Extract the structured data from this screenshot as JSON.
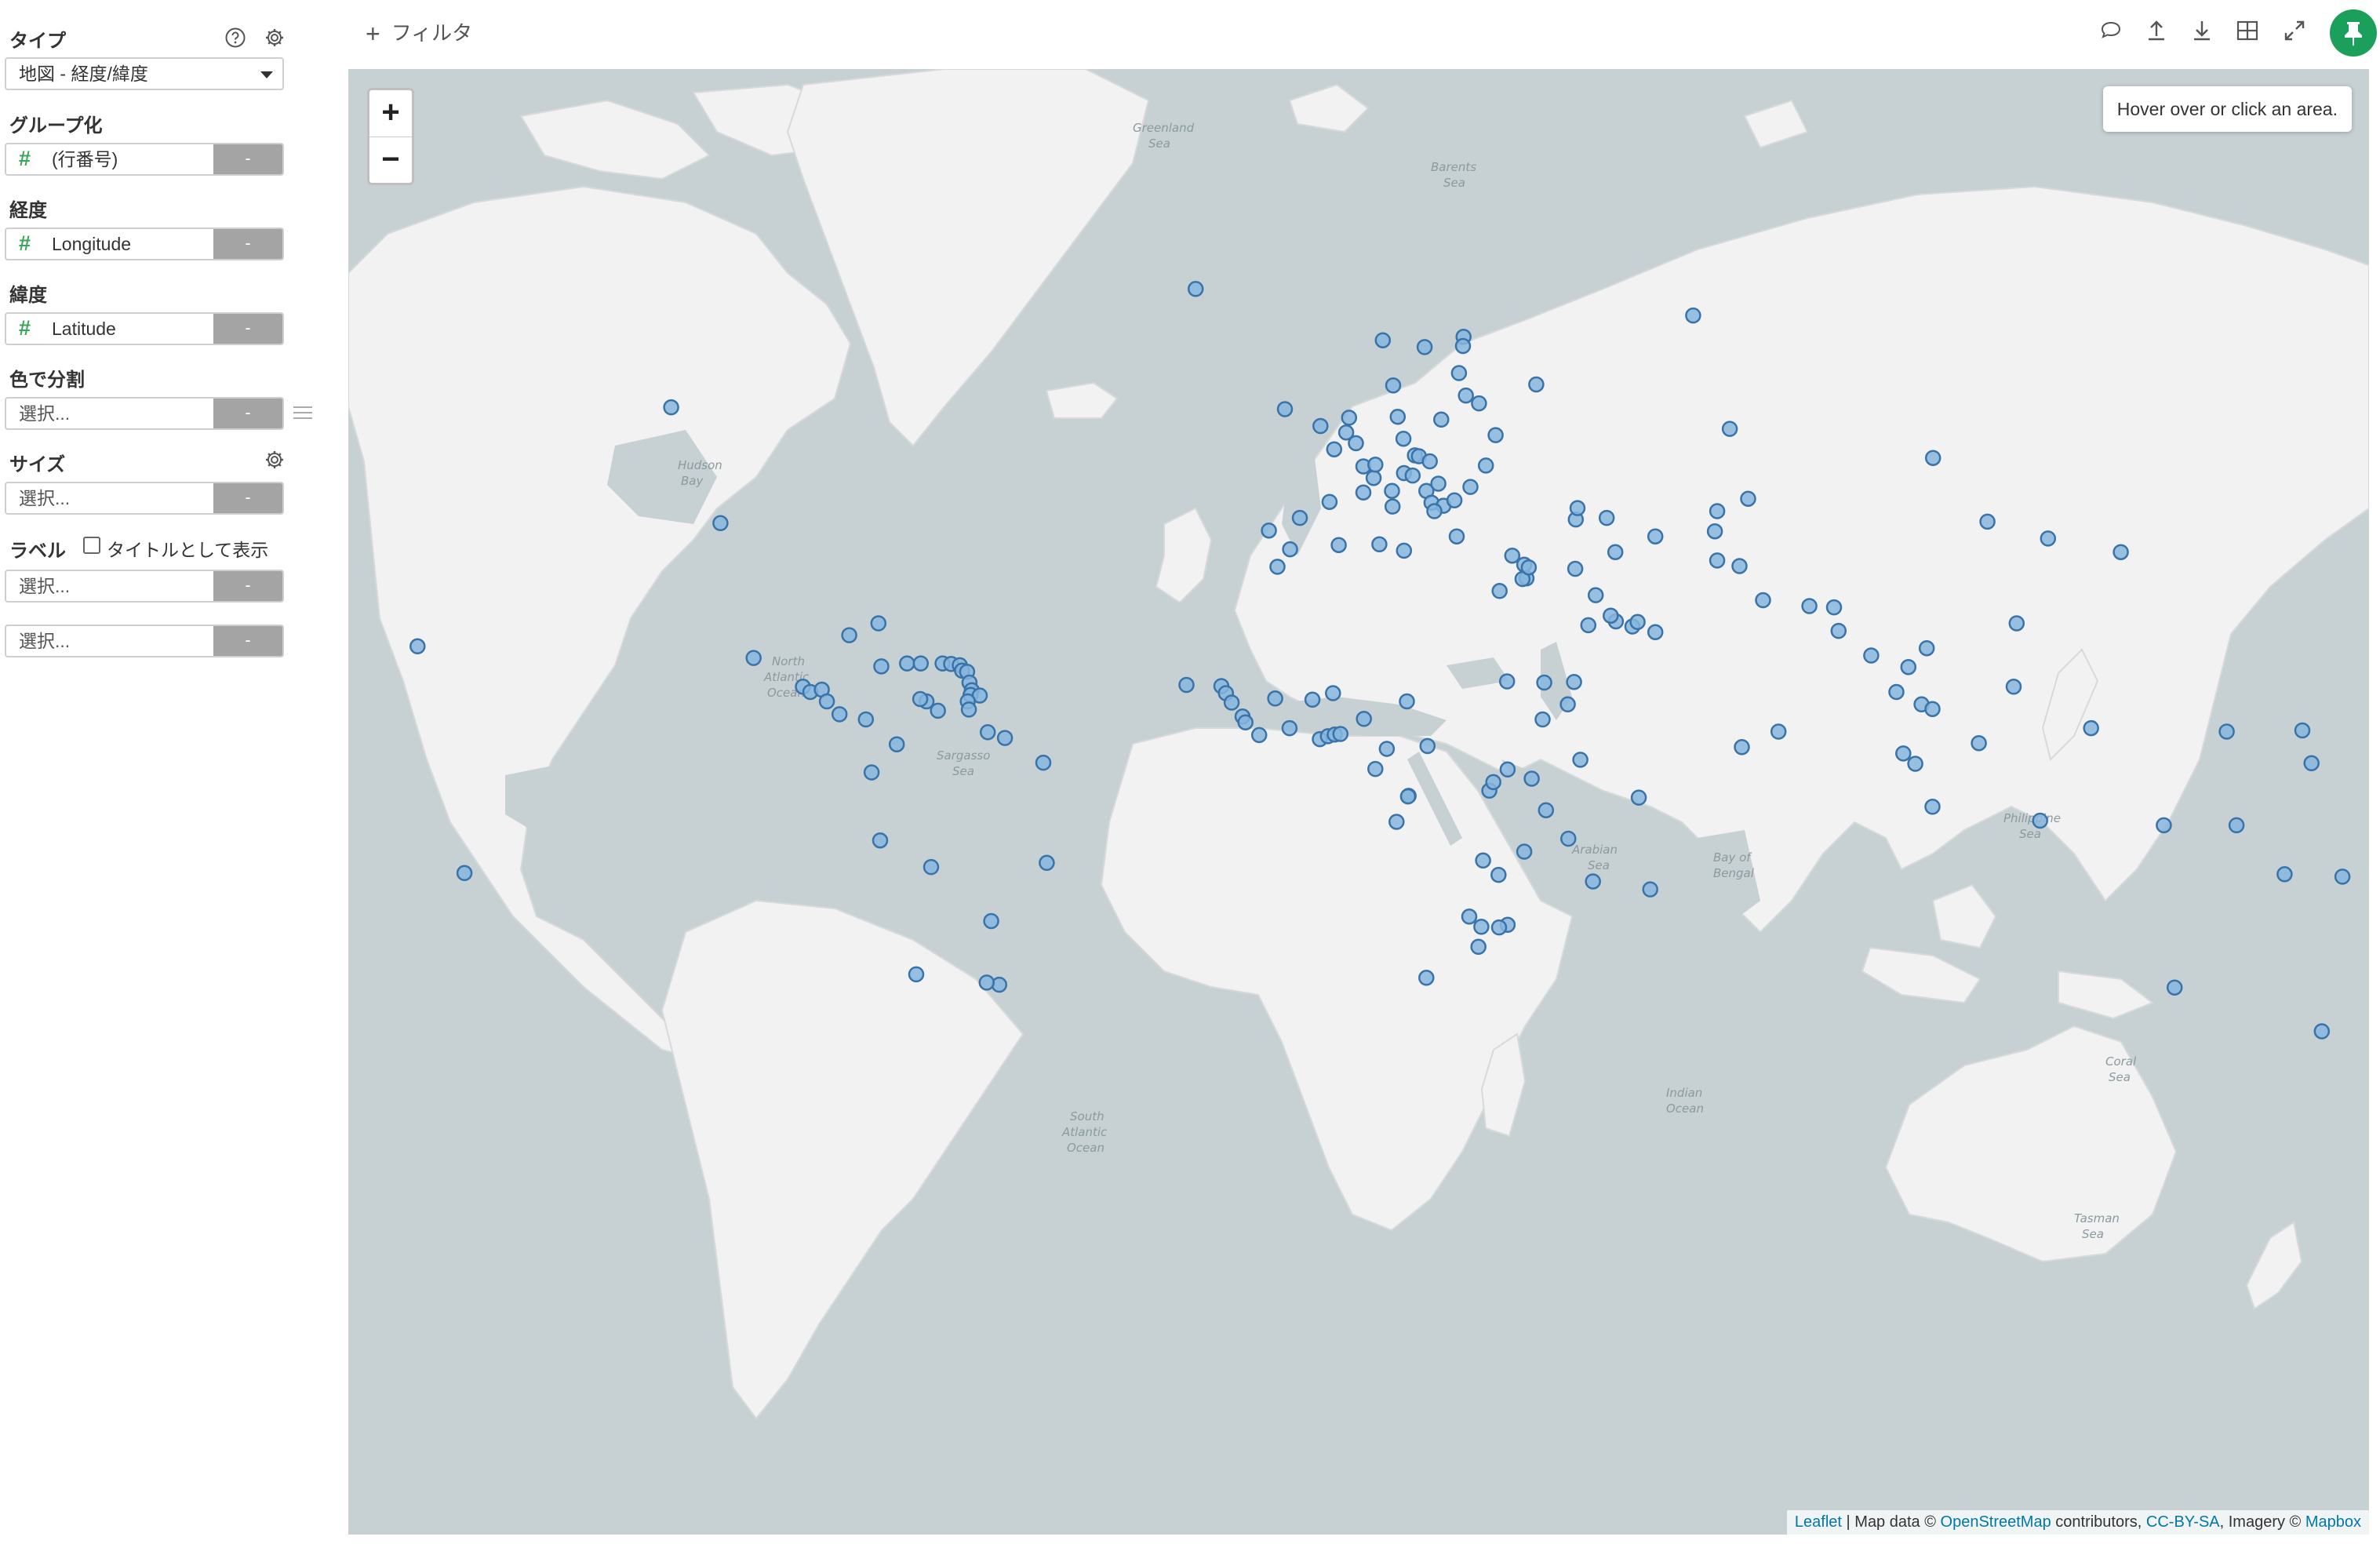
{
  "panel": {
    "type_label": "タイプ",
    "type_value": "地図 - 経度/緯度",
    "group_label": "グループ化",
    "group_value": "(行番号)",
    "lon_label": "経度",
    "lon_value": "Longitude",
    "lat_label": "緯度",
    "lat_value": "Latitude",
    "color_label": "色で分割",
    "size_label": "サイズ",
    "label_label": "ラベル",
    "title_checkbox_label": "タイトルとして表示",
    "placeholder": "選択...",
    "minus": "-"
  },
  "toolbar": {
    "filter_label": "フィルタ",
    "icons": [
      "comment-icon",
      "upload-icon",
      "download-icon",
      "table-icon",
      "expand-icon",
      "pin-icon"
    ]
  },
  "map": {
    "zoom_in": "+",
    "zoom_out": "−",
    "info_text": "Hover over or click an area.",
    "attribution": {
      "leaflet": "Leaflet",
      "text1": " | Map data © ",
      "osm": "OpenStreetMap",
      "text2": " contributors, ",
      "license": "CC-BY-SA",
      "text3": ", Imagery © ",
      "mapbox": "Mapbox"
    },
    "colors": {
      "land": "#f2f2f2",
      "water": "#c7d1d4",
      "marker_fill": "#86b6df",
      "marker_stroke": "#3a73a8"
    },
    "points": [
      [
        -113.5,
        53.5
      ],
      [
        -104.9,
        39.7
      ],
      [
        -99.1,
        19.4
      ],
      [
        -90.5,
        14.6
      ],
      [
        -89.2,
        13.7
      ],
      [
        -87.2,
        14.1
      ],
      [
        -86.3,
        12.1
      ],
      [
        -84.1,
        9.9
      ],
      [
        -79.5,
        9.0
      ],
      [
        -77.3,
        25.0
      ],
      [
        -82.4,
        23.1
      ],
      [
        -76.8,
        18.0
      ],
      [
        -72.3,
        18.5
      ],
      [
        -69.9,
        18.5
      ],
      [
        -66.1,
        18.5
      ],
      [
        -64.6,
        18.4
      ],
      [
        -63.1,
        18.2
      ],
      [
        -62.7,
        17.3
      ],
      [
        -61.8,
        17.1
      ],
      [
        -61.4,
        15.3
      ],
      [
        -61.0,
        14.0
      ],
      [
        -61.2,
        13.2
      ],
      [
        -59.6,
        13.1
      ],
      [
        -61.7,
        12.1
      ],
      [
        -61.5,
        10.7
      ],
      [
        -68.9,
        12.1
      ],
      [
        -70.0,
        12.5
      ],
      [
        -66.9,
        10.5
      ],
      [
        -58.2,
        6.8
      ],
      [
        -55.2,
        5.8
      ],
      [
        -74.1,
        4.7
      ],
      [
        -78.5,
        -0.2
      ],
      [
        -77.0,
        -12.0
      ],
      [
        -68.1,
        -16.5
      ],
      [
        -57.6,
        -25.3
      ],
      [
        -47.9,
        -15.8
      ],
      [
        -56.2,
        -34.9
      ],
      [
        -58.4,
        -34.6
      ],
      [
        -70.7,
        -33.4
      ],
      [
        -21.9,
        64.1
      ],
      [
        -6.3,
        53.3
      ],
      [
        -0.1,
        51.5
      ],
      [
        2.3,
        48.9
      ],
      [
        4.4,
        50.8
      ],
      [
        6.1,
        49.6
      ],
      [
        4.9,
        52.4
      ],
      [
        12.6,
        55.7
      ],
      [
        10.8,
        59.9
      ],
      [
        18.1,
        59.3
      ],
      [
        24.9,
        60.2
      ],
      [
        24.1,
        56.9
      ],
      [
        25.3,
        54.7
      ],
      [
        24.8,
        59.4
      ],
      [
        27.6,
        53.9
      ],
      [
        21.0,
        52.2
      ],
      [
        13.4,
        52.5
      ],
      [
        14.4,
        50.1
      ],
      [
        16.4,
        48.2
      ],
      [
        17.1,
        48.1
      ],
      [
        19.0,
        47.5
      ],
      [
        14.5,
        46.1
      ],
      [
        16.0,
        45.8
      ],
      [
        18.4,
        43.9
      ],
      [
        20.5,
        44.8
      ],
      [
        19.3,
        42.4
      ],
      [
        21.4,
        42.0
      ],
      [
        19.8,
        41.3
      ],
      [
        23.7,
        37.9
      ],
      [
        23.3,
        42.7
      ],
      [
        26.1,
        44.4
      ],
      [
        28.8,
        47.0
      ],
      [
        30.5,
        50.5
      ],
      [
        12.5,
        41.9
      ],
      [
        9.2,
        45.5
      ],
      [
        7.4,
        46.9
      ],
      [
        9.5,
        47.1
      ],
      [
        7.4,
        43.7
      ],
      [
        12.4,
        43.9
      ],
      [
        14.5,
        35.9
      ],
      [
        -3.7,
        40.4
      ],
      [
        -9.1,
        38.7
      ],
      [
        1.5,
        42.5
      ],
      [
        -5.4,
        36.1
      ],
      [
        10.2,
        36.8
      ],
      [
        3.1,
        36.7
      ],
      [
        -7.6,
        33.6
      ],
      [
        -17.4,
        14.7
      ],
      [
        -16.6,
        13.5
      ],
      [
        -15.6,
        11.9
      ],
      [
        -13.7,
        9.5
      ],
      [
        -13.2,
        8.5
      ],
      [
        -10.8,
        6.3
      ],
      [
        -5.5,
        7.5
      ],
      [
        -1.5,
        12.4
      ],
      [
        -8.0,
        12.6
      ],
      [
        2.1,
        13.5
      ],
      [
        -0.2,
        5.6
      ],
      [
        1.2,
        6.1
      ],
      [
        2.4,
        6.4
      ],
      [
        3.4,
        6.5
      ],
      [
        7.5,
        9.1
      ],
      [
        15.0,
        12.1
      ],
      [
        18.6,
        4.4
      ],
      [
        9.5,
        0.4
      ],
      [
        11.5,
        3.9
      ],
      [
        15.3,
        -4.3
      ],
      [
        15.2,
        -4.4
      ],
      [
        13.2,
        -8.8
      ],
      [
        28.3,
        -15.4
      ],
      [
        31.0,
        -17.8
      ],
      [
        35.5,
        -13.9
      ],
      [
        32.6,
        -25.9
      ],
      [
        28.0,
        -26.2
      ],
      [
        31.1,
        -26.3
      ],
      [
        27.5,
        -29.3
      ],
      [
        25.9,
        -24.6
      ],
      [
        18.4,
        -33.9
      ],
      [
        29.4,
        -3.4
      ],
      [
        30.1,
        -1.9
      ],
      [
        32.6,
        0.3
      ],
      [
        36.8,
        -1.3
      ],
      [
        39.3,
        -6.8
      ],
      [
        38.7,
        9.0
      ],
      [
        32.5,
        15.5
      ],
      [
        31.2,
        30.0
      ],
      [
        43.1,
        11.6
      ],
      [
        45.3,
        2.0
      ],
      [
        39.0,
        15.3
      ],
      [
        44.2,
        15.4
      ],
      [
        35.5,
        33.9
      ],
      [
        35.9,
        31.9
      ],
      [
        35.2,
        31.8
      ],
      [
        36.3,
        33.5
      ],
      [
        33.4,
        35.2
      ],
      [
        44.4,
        33.3
      ],
      [
        46.7,
        24.7
      ],
      [
        51.5,
        25.3
      ],
      [
        50.6,
        26.2
      ],
      [
        54.4,
        24.5
      ],
      [
        55.3,
        25.2
      ],
      [
        58.4,
        23.6
      ],
      [
        47.98,
        29.37
      ],
      [
        51.4,
        35.7
      ],
      [
        44.5,
        40.2
      ],
      [
        44.8,
        41.7
      ],
      [
        49.9,
        40.4
      ],
      [
        58.4,
        37.9
      ],
      [
        69.2,
        41.3
      ],
      [
        71.4,
        51.2
      ],
      [
        74.6,
        42.9
      ],
      [
        68.8,
        38.6
      ],
      [
        69.2,
        34.5
      ],
      [
        73.1,
        33.7
      ],
      [
        85.3,
        27.7
      ],
      [
        77.2,
        28.6
      ],
      [
        90.4,
        23.8
      ],
      [
        89.6,
        27.5
      ],
      [
        96.1,
        19.8
      ],
      [
        100.5,
        13.7
      ],
      [
        104.9,
        11.6
      ],
      [
        102.6,
        17.9
      ],
      [
        105.8,
        21.0
      ],
      [
        106.8,
        10.8
      ],
      [
        101.7,
        3.1
      ],
      [
        114.9,
        4.9
      ],
      [
        103.8,
        1.3
      ],
      [
        106.8,
        -6.2
      ],
      [
        116.4,
        39.9
      ],
      [
        126.98,
        37.6
      ],
      [
        139.7,
        35.7
      ],
      [
        121.5,
        25.0
      ],
      [
        120.98,
        14.6
      ],
      [
        125.6,
        -8.6
      ],
      [
        147.2,
        -9.4
      ],
      [
        106.9,
        47.9
      ],
      [
        37.6,
        55.8
      ],
      [
        79.9,
        6.9
      ],
      [
        73.5,
        4.2
      ],
      [
        57.5,
        -20.2
      ],
      [
        55.5,
        -4.6
      ],
      [
        47.5,
        -18.9
      ],
      [
        43.2,
        -11.7
      ],
      [
        149.1,
        -35.3
      ],
      [
        174.8,
        -41.3
      ],
      [
        159.9,
        -9.4
      ],
      [
        168.3,
        -17.7
      ],
      [
        178.4,
        -18.1
      ],
      [
        134.5,
        7.5
      ],
      [
        158.2,
        6.9
      ],
      [
        171.4,
        7.1
      ],
      [
        173.0,
        1.4
      ],
      [
        -23.5,
        14.9
      ],
      [
        -172.1,
        -13.8
      ],
      [
        -175.2,
        -21.1
      ],
      [
        -157.8,
        21.3
      ],
      [
        -149.6,
        -17.5
      ],
      [
        65.0,
        62.0
      ],
      [
        -48.5,
        1.5
      ]
    ]
  }
}
